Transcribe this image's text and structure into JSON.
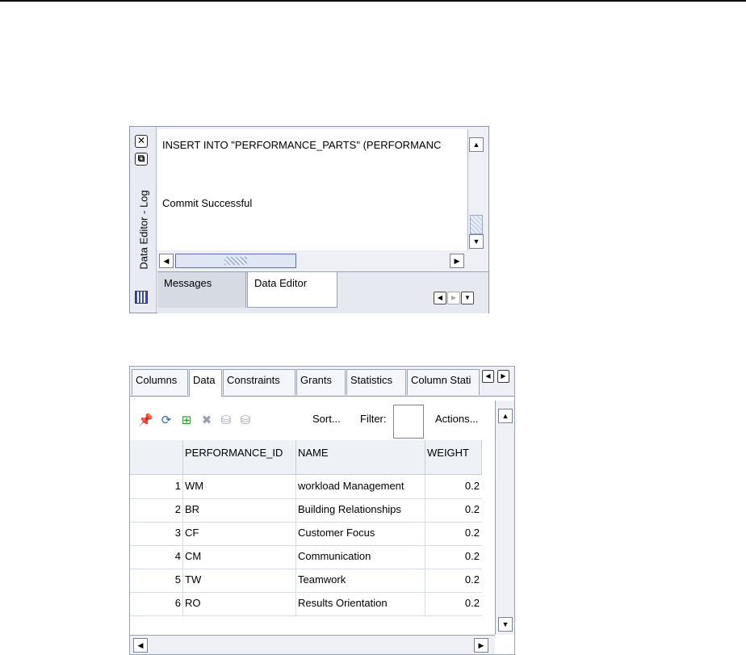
{
  "log_panel": {
    "side_title": "Data Editor - Log",
    "lines": [
      "INSERT INTO \"PERFORMANCE_PARTS\" (PERFORMANC",
      "Commit Successful"
    ],
    "tabs": [
      {
        "label": "Messages",
        "active": false
      },
      {
        "label": "Data Editor",
        "active": true
      }
    ]
  },
  "table_panel": {
    "tabs": [
      {
        "label": "Columns",
        "active": false
      },
      {
        "label": "Data",
        "active": true
      },
      {
        "label": "Constraints",
        "active": false
      },
      {
        "label": "Grants",
        "active": false
      },
      {
        "label": "Statistics",
        "active": false
      },
      {
        "label": "Column Stati",
        "active": false
      }
    ],
    "toolbar": {
      "icons": [
        "pin-icon",
        "refresh-icon",
        "insert-row-icon",
        "delete-row-icon",
        "commit-icon",
        "rollback-icon"
      ],
      "sort_label": "Sort...",
      "filter_label": "Filter:",
      "filter_value": "",
      "actions_label": "Actions..."
    },
    "columns": [
      "",
      "PERFORMANCE_ID",
      "NAME",
      "WEIGHT"
    ],
    "rows": [
      {
        "num": "1",
        "id": "WM",
        "name": "workload Management",
        "weight": "0.2"
      },
      {
        "num": "2",
        "id": "BR",
        "name": "Building Relationships",
        "weight": "0.2"
      },
      {
        "num": "3",
        "id": "CF",
        "name": "Customer Focus",
        "weight": "0.2"
      },
      {
        "num": "4",
        "id": "CM",
        "name": "Communication",
        "weight": "0.2"
      },
      {
        "num": "5",
        "id": "TW",
        "name": "Teamwork",
        "weight": "0.2"
      },
      {
        "num": "6",
        "id": "RO",
        "name": "Results Orientation",
        "weight": "0.2"
      }
    ]
  }
}
